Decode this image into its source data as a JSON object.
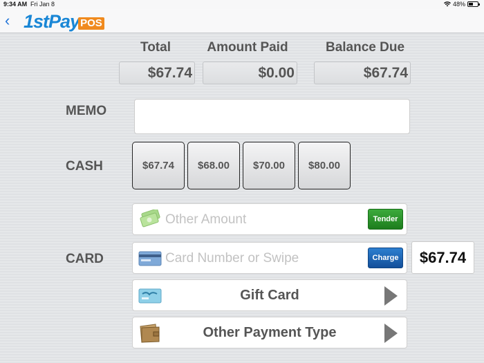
{
  "status": {
    "time": "9:34 AM",
    "date": "Fri Jan 8",
    "battery": "48%",
    "battery_level": 0.48
  },
  "nav": {
    "back_glyph": "‹",
    "logo_main": "1stPay",
    "logo_badge": "POS"
  },
  "summary": {
    "total_label": "Total",
    "total_value": "$67.74",
    "paid_label": "Amount Paid",
    "paid_value": "$0.00",
    "balance_label": "Balance Due",
    "balance_value": "$67.74"
  },
  "memo": {
    "label": "MEMO",
    "value": ""
  },
  "cash": {
    "label": "CASH",
    "options": [
      "$67.74",
      "$68.00",
      "$70.00",
      "$80.00"
    ]
  },
  "other_amount": {
    "placeholder": "Other Amount",
    "button": "Tender"
  },
  "card": {
    "label": "CARD",
    "placeholder": "Card Number or Swipe",
    "button": "Charge",
    "amount": "$67.74"
  },
  "gift_card": {
    "label": "Gift Card"
  },
  "other_payment": {
    "label": "Other Payment Type"
  },
  "icons": {
    "cash": "money-stack-icon",
    "card": "credit-card-icon",
    "gift": "gift-card-icon",
    "wallet": "wallet-icon",
    "chevron": "chevron-right-icon",
    "wifi": "wifi-icon",
    "battery": "battery-icon",
    "back": "back-chevron-icon"
  },
  "colors": {
    "brand_blue": "#1a87d6",
    "brand_orange": "#f08a1e",
    "tender_green": "#2a9a2a",
    "charge_blue": "#1f64b8"
  }
}
